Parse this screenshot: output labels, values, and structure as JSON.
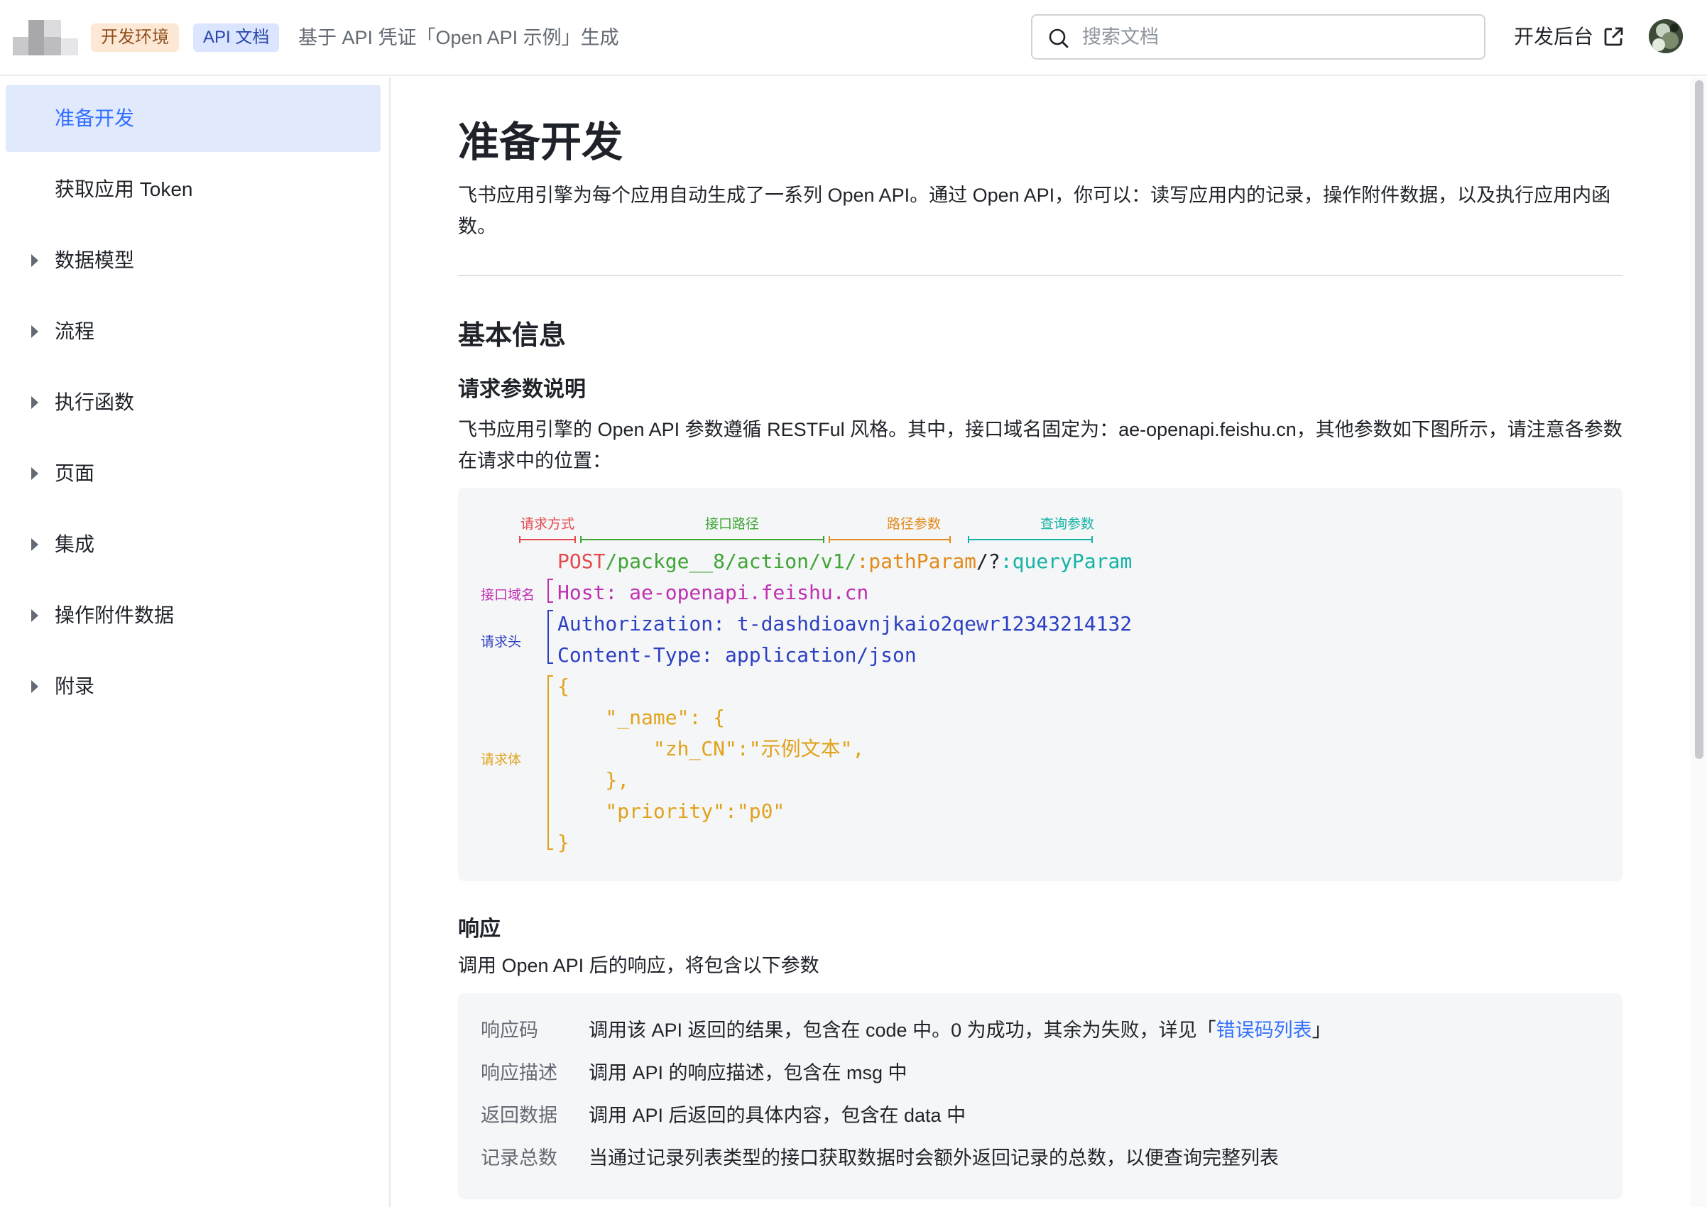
{
  "header": {
    "badge_env": "开发环境",
    "badge_api": "API 文档",
    "subtitle": "基于 API 凭证「Open API 示例」生成",
    "search_placeholder": "搜索文档",
    "console_label": "开发后台",
    "icons": {
      "search": "search-icon",
      "external": "external-link-icon"
    }
  },
  "sidebar": {
    "items": [
      {
        "label": "准备开发",
        "active": true,
        "expandable": false
      },
      {
        "label": "获取应用 Token",
        "active": false,
        "expandable": false
      },
      {
        "label": "数据模型",
        "active": false,
        "expandable": true
      },
      {
        "label": "流程",
        "active": false,
        "expandable": true
      },
      {
        "label": "执行函数",
        "active": false,
        "expandable": true
      },
      {
        "label": "页面",
        "active": false,
        "expandable": true
      },
      {
        "label": "集成",
        "active": false,
        "expandable": true
      },
      {
        "label": "操作附件数据",
        "active": false,
        "expandable": true
      },
      {
        "label": "附录",
        "active": false,
        "expandable": true
      }
    ]
  },
  "main": {
    "title": "准备开发",
    "intro": "飞书应用引擎为每个应用自动生成了一系列 Open API。通过 Open API，你可以：读写应用内的记录，操作附件数据，以及执行应用内函数。",
    "section_basic": "基本信息",
    "sub_request": "请求参数说明",
    "request_desc": "飞书应用引擎的 Open API 参数遵循 RESTFul 风格。其中，接口域名固定为：ae-openapi.feishu.cn，其他参数如下图所示，请注意各参数在请求中的位置：",
    "diagram": {
      "labels": {
        "method": "请求方式",
        "path": "接口路径",
        "path_param": "路径参数",
        "query_param": "查询参数",
        "host": "接口域名",
        "headers": "请求头",
        "body": "请求体"
      },
      "line_method": "POST",
      "line_path": "/packge__8/action/v1/",
      "line_path_param": ":pathParam",
      "line_qmark": "/?",
      "line_query": ":queryParam",
      "host_line": "Host: ae-openapi.feishu.cn",
      "auth_line": "Authorization: t-dashdioavnjkaio2qewr12343214132",
      "ctype_line": "Content-Type: application/json",
      "body_lines": [
        "{",
        "    \"_name\": {",
        "        \"zh_CN\":\"示例文本\",",
        "    },",
        "    \"priority\":\"p0\"",
        "}"
      ],
      "colors": {
        "method": "#e5484d",
        "path": "#3fa535",
        "path_param": "#e38a1a",
        "query": "#14b3a5",
        "host": "#c02fb3",
        "headers": "#2d3fc2",
        "body": "#e0a21a"
      }
    },
    "sub_response": "响应",
    "response_desc": "调用 Open API 后的响应，将包含以下参数",
    "response_rows": [
      {
        "key": "响应码",
        "value": "调用该 API 返回的结果，包含在 code 中。0 为成功，其余为失败，详见「",
        "link": "错误码列表",
        "suffix": "」"
      },
      {
        "key": "响应描述",
        "value": "调用 API 的响应描述，包含在 msg 中"
      },
      {
        "key": "返回数据",
        "value": "调用 API 后返回的具体内容，包含在 data 中"
      },
      {
        "key": "记录总数",
        "value": "当通过记录列表类型的接口获取数据时会额外返回记录的总数，以便查询完整列表"
      }
    ]
  }
}
